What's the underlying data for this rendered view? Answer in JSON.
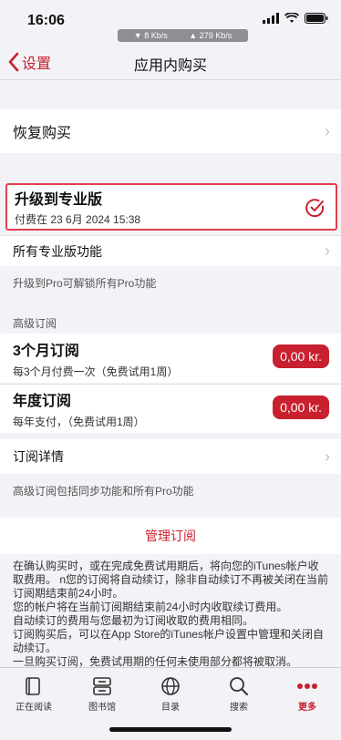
{
  "status": {
    "time": "16:06",
    "down": "▼ 8 Kb/s",
    "up": "▲ 279 Kb/s"
  },
  "nav": {
    "back_label": "设置",
    "title": "应用内购买"
  },
  "restore": {
    "label": "恢复购买"
  },
  "pro": {
    "title": "升级到专业版",
    "subtitle": "付费在 23 6月 2024 15:38"
  },
  "features": {
    "label": "所有专业版功能",
    "hint": "升级到Pro可解锁所有Pro功能"
  },
  "premium_header": "高级订阅",
  "subs": [
    {
      "title": "3个月订阅",
      "desc": "每3个月付费一次（免费试用1周）",
      "price": "0,00 kr."
    },
    {
      "title": "年度订阅",
      "desc": "每年支付，（免费试用1周）",
      "price": "0,00 kr."
    }
  ],
  "details": {
    "label": "订阅详情",
    "hint": "高级订阅包括同步功能和所有Pro功能"
  },
  "manage": {
    "label": "管理订阅"
  },
  "legal": [
    "在确认购买时，或在完成免费试用期后，将向您的iTunes帐户收取费用。 n您的订阅将自动续订，除非自动续订不再被关闭在当前订阅期结束前24小时。",
    "您的帐户将在当前订阅期结束前24小时内收取续订费用。",
    "自动续订的费用与您最初为订阅收取的费用相同。",
    "订阅购买后，可以在App Store的iTunes帐户设置中管理和关闭自动续订。",
    "一旦购买订阅，免费试用期的任何未使用部分都将被取消。"
  ],
  "tabs": [
    {
      "label": "正在阅读",
      "icon": "book-icon"
    },
    {
      "label": "图书馆",
      "icon": "library-icon"
    },
    {
      "label": "目录",
      "icon": "globe-icon"
    },
    {
      "label": "搜索",
      "icon": "search-icon"
    },
    {
      "label": "更多",
      "icon": "more-icon"
    }
  ],
  "colors": {
    "accent": "#c8202e",
    "background": "#f2f2f7"
  }
}
